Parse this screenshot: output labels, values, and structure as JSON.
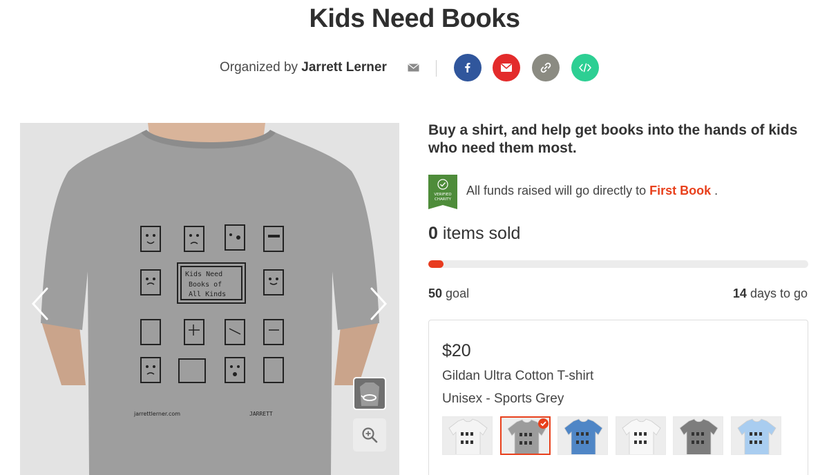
{
  "page": {
    "title": "Kids Need Books"
  },
  "organizer": {
    "prefix": "Organized by",
    "name": "Jarrett Lerner",
    "share_icons": [
      "facebook-icon",
      "email-icon",
      "link-icon",
      "embed-code-icon"
    ]
  },
  "colors": {
    "brand_red": "#e8401c",
    "facebook": "#30569c",
    "email": "#e32b2b",
    "link": "#8b8b82",
    "embed": "#2dcf93",
    "shirt_grey": "#9e9e9e",
    "verified_green": "#4e8c3a"
  },
  "campaign": {
    "headline": "Buy a shirt, and help get books into the hands of kids who need them most.",
    "verified_badge_line1": "VERIFIED",
    "verified_badge_line2": "CHARITY",
    "funds_text": "All funds raised will go directly to",
    "charity_name": "First Book",
    "funds_suffix": ".",
    "items_sold_count": "0",
    "items_sold_label": "items sold",
    "progress_fraction": 0.04,
    "goal_count": "50",
    "goal_label": "goal",
    "days_count": "14",
    "days_label": "days to go"
  },
  "shirt_design": {
    "lines": [
      "Kids  Need",
      "Books of",
      "All Kinds"
    ],
    "site": "jarrettlerner.com",
    "signature": "JARRETT"
  },
  "product": {
    "price": "$20",
    "name": "Gildan Ultra Cotton T-shirt",
    "variant": "Unisex - Sports Grey",
    "swatches": [
      {
        "color": "#f4f4f4",
        "selected": false
      },
      {
        "color": "#9c9c9c",
        "selected": true
      },
      {
        "color": "#4f86c6",
        "selected": false
      },
      {
        "color": "#f7f7f7",
        "selected": false
      },
      {
        "color": "#7d7d7d",
        "selected": false
      },
      {
        "color": "#a9cdf0",
        "selected": false
      }
    ]
  }
}
